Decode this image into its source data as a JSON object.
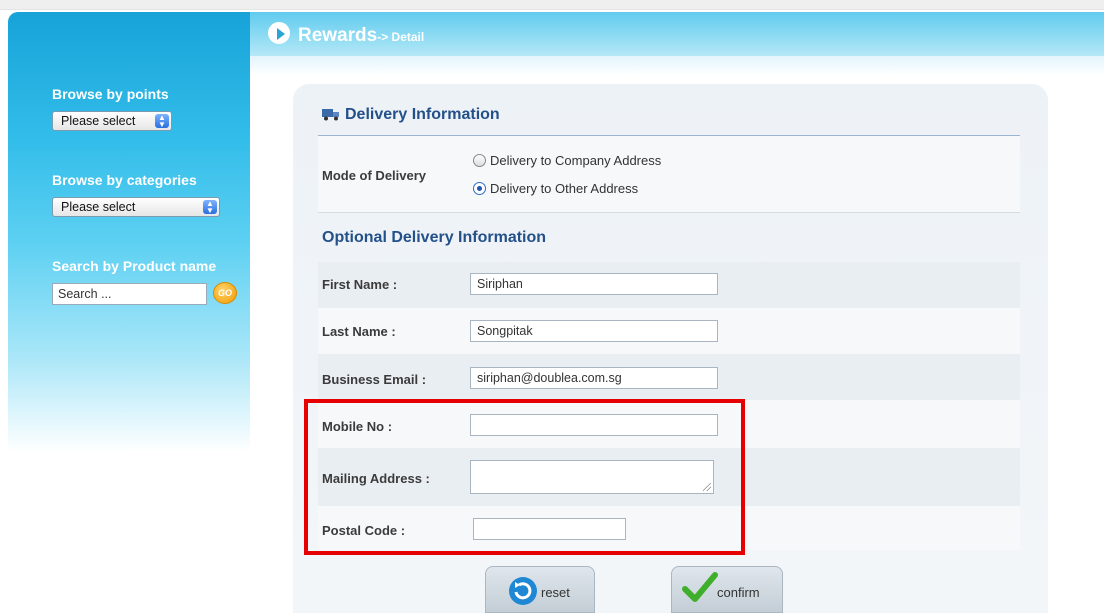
{
  "header": {
    "title": "Rewards",
    "subtitle": "-> Detail"
  },
  "sidebar": {
    "points_label": "Browse by points",
    "points_value": "Please select",
    "categories_label": "Browse by categories",
    "categories_value": "Please select",
    "search_label": "Search by Product name",
    "search_placeholder": "Search ...",
    "go_label": "GO"
  },
  "delivery": {
    "title": "Delivery Information",
    "mode_label": "Mode of Delivery",
    "options": [
      {
        "label": "Delivery to Company Address",
        "selected": false
      },
      {
        "label": "Delivery to Other Address",
        "selected": true
      }
    ]
  },
  "optional": {
    "title": "Optional Delivery Information",
    "first_name_label": "First Name :",
    "first_name_value": "Siriphan",
    "last_name_label": "Last Name :",
    "last_name_value": "Songpitak",
    "email_label": "Business Email :",
    "email_value": "siriphan@doublea.com.sg",
    "mobile_label": "Mobile No :",
    "mobile_value": "",
    "address_label": "Mailing Address :",
    "address_value": "",
    "postal_label": "Postal Code :",
    "postal_value": ""
  },
  "actions": {
    "reset_label": "reset",
    "confirm_label": "confirm"
  },
  "colors": {
    "accent": "#24508a",
    "highlight": "#e60000",
    "header": "#61cbee"
  }
}
